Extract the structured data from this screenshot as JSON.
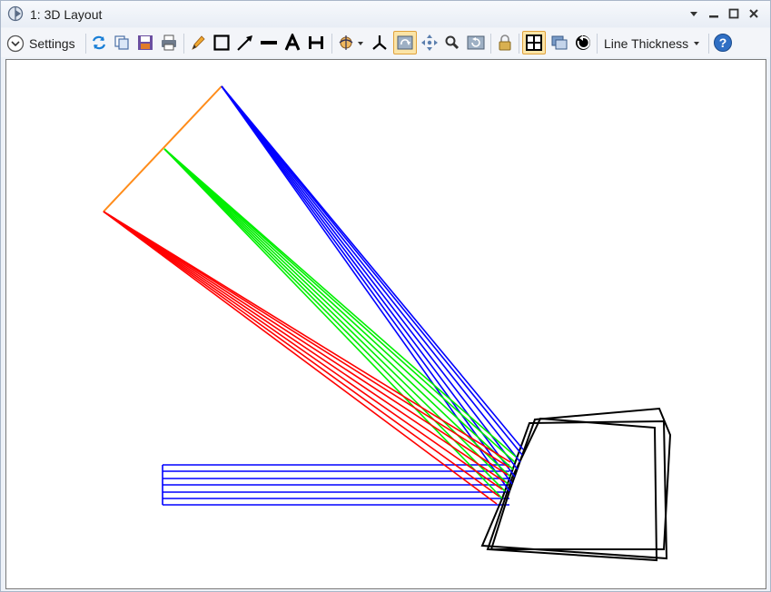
{
  "window": {
    "title": "1: 3D Layout"
  },
  "toolbar": {
    "settings_label": "Settings",
    "line_thickness_label": "Line Thickness",
    "icons": [
      "refresh-icon",
      "copy-icon",
      "save-icon",
      "print-icon",
      "pencil-icon",
      "rectangle-icon",
      "arrow-icon",
      "line-icon",
      "text-icon",
      "dimension-icon",
      "rotate-view-icon",
      "axes-icon",
      "rotate-icon",
      "pan-icon",
      "zoom-icon",
      "reset-view-icon",
      "lock-icon",
      "grid-icon",
      "window-icon",
      "snap-icon",
      "help-icon"
    ]
  },
  "colors": {
    "blue": "#0000ff",
    "green": "#00ee00",
    "red": "#ff0000",
    "orange": "#ff8c1a",
    "black": "#000000"
  }
}
